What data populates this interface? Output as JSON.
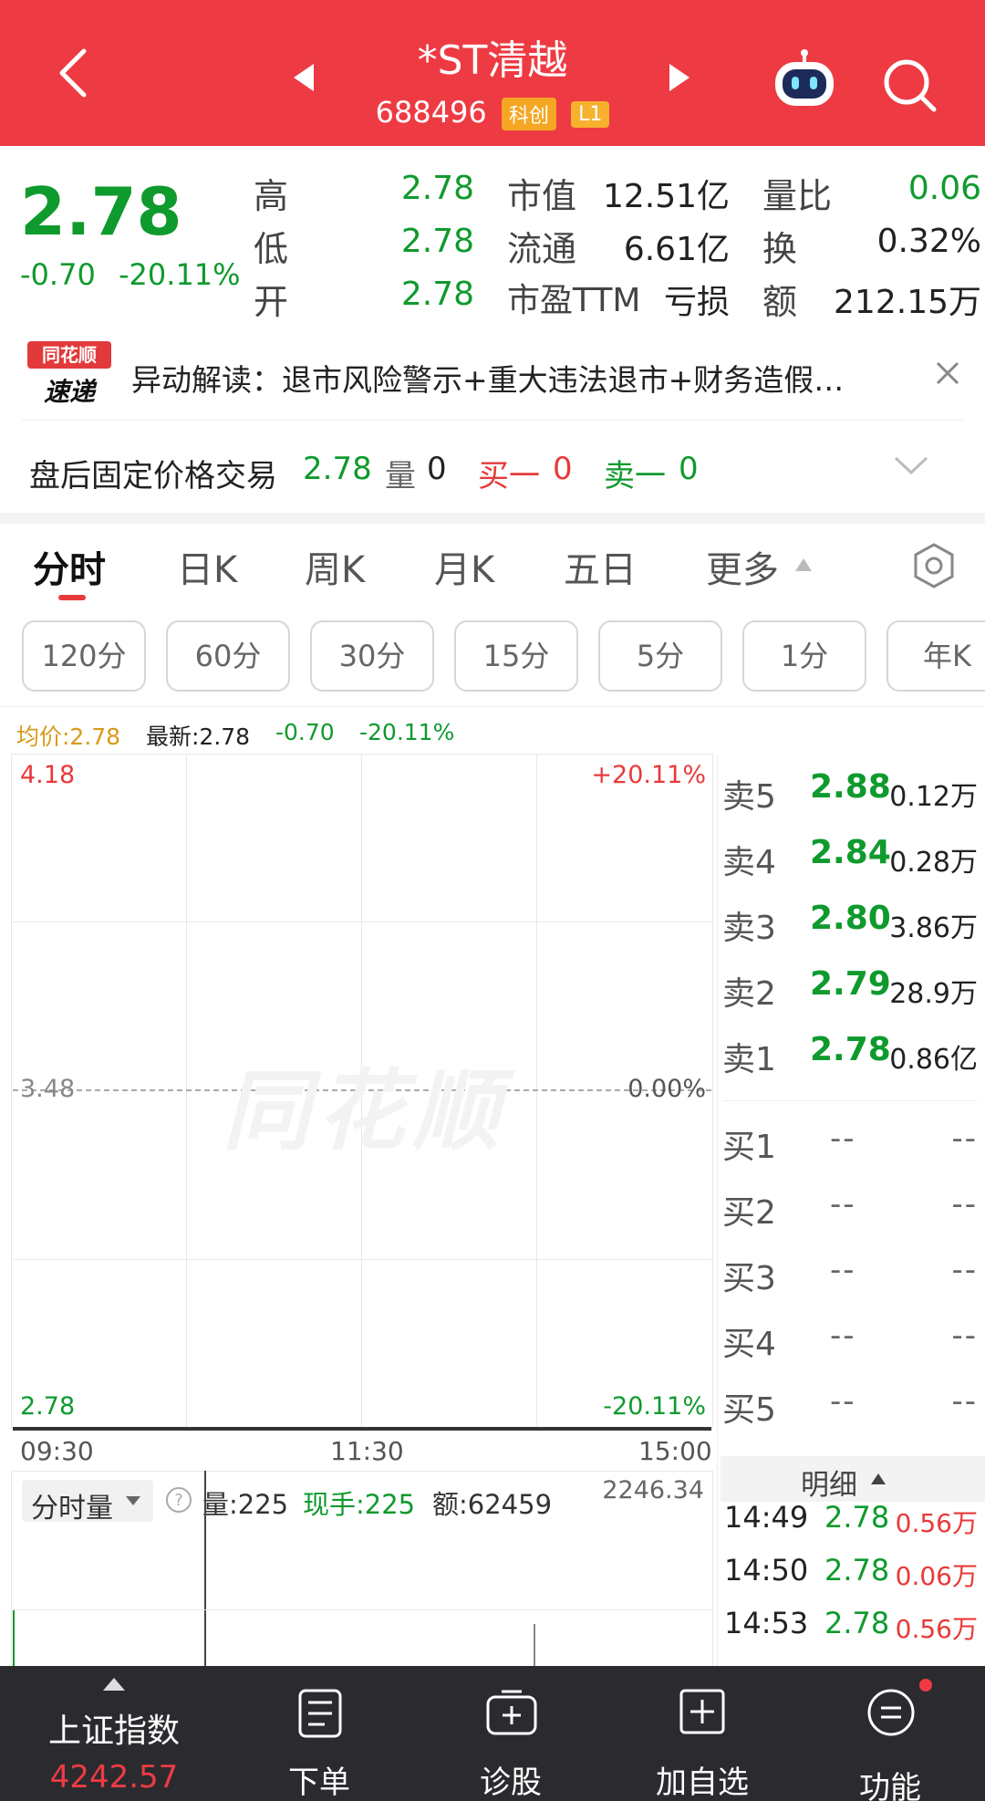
{
  "header": {
    "stock_name": "*ST清越",
    "stock_code": "688496",
    "tag_board": "科创",
    "tag_level": "L1"
  },
  "quote": {
    "price": "2.78",
    "change": "-0.70",
    "change_pct": "-20.11%",
    "fields": [
      {
        "label": "高",
        "value": "2.78"
      },
      {
        "label": "低",
        "value": "2.78"
      },
      {
        "label": "开",
        "value": "2.78"
      },
      {
        "label": "市值",
        "value": "12.51亿"
      },
      {
        "label": "流通",
        "value": "6.61亿"
      },
      {
        "label": "市盈TTM",
        "value": "亏损"
      },
      {
        "label": "量比",
        "value": "0.06"
      },
      {
        "label": "换",
        "value": "0.32%"
      },
      {
        "label": "额",
        "value": "212.15万"
      }
    ]
  },
  "news": {
    "logo_top": "同花顺",
    "logo_bottom": "速递",
    "text": "异动解读：退市风险警示+重大违法退市+财务造假…"
  },
  "after_hours": {
    "label": "盘后固定价格交易",
    "price": "2.78",
    "vol_label": "量",
    "vol": "0",
    "buy1_label": "买一",
    "buy1": "0",
    "sell1_label": "卖一",
    "sell1": "0"
  },
  "tabs": [
    "分时",
    "日K",
    "周K",
    "月K",
    "五日",
    "更多"
  ],
  "subtabs": [
    "120分",
    "60分",
    "30分",
    "15分",
    "5分",
    "1分",
    "年K"
  ],
  "chart_header": {
    "avg_label": "均价:2.78",
    "latest_label": "最新:2.78",
    "change": "-0.70",
    "change_pct": "-20.11%"
  },
  "chart_data": {
    "type": "line",
    "y_left": {
      "top": "4.18",
      "mid": "3.48",
      "bottom": "2.78"
    },
    "y_right": {
      "top": "+20.11%",
      "mid": "0.00%",
      "bottom": "-20.11%"
    },
    "x_ticks": [
      "09:30",
      "11:30",
      "15:00"
    ],
    "watermark": "同花顺"
  },
  "order_book": {
    "sells": [
      {
        "label": "卖5",
        "price": "2.88",
        "vol": "0.12万"
      },
      {
        "label": "卖4",
        "price": "2.84",
        "vol": "0.28万"
      },
      {
        "label": "卖3",
        "price": "2.80",
        "vol": "3.86万"
      },
      {
        "label": "卖2",
        "price": "2.79",
        "vol": "28.9万"
      },
      {
        "label": "卖1",
        "price": "2.78",
        "vol": "0.86亿"
      }
    ],
    "buys": [
      {
        "label": "买1",
        "price": "--",
        "vol": "--"
      },
      {
        "label": "买2",
        "price": "--",
        "vol": "--"
      },
      {
        "label": "买3",
        "price": "--",
        "vol": "--"
      },
      {
        "label": "买4",
        "price": "--",
        "vol": "--"
      },
      {
        "label": "买5",
        "price": "--",
        "vol": "--"
      }
    ]
  },
  "volume_panel": {
    "selector": "分时量",
    "vol": "量:225",
    "hand": "现手:225",
    "amount": "额:62459",
    "max": "2246.34"
  },
  "ticks": {
    "header": "明细",
    "rows": [
      {
        "time": "14:49",
        "price": "2.78",
        "vol": "0.56万"
      },
      {
        "time": "14:50",
        "price": "2.78",
        "vol": "0.06万"
      },
      {
        "time": "14:53",
        "price": "2.78",
        "vol": "0.56万"
      }
    ]
  },
  "bottom_bar": {
    "index_name": "上证指数",
    "index_value": "4242.57",
    "items": [
      "下单",
      "诊股",
      "加自选",
      "功能"
    ]
  }
}
